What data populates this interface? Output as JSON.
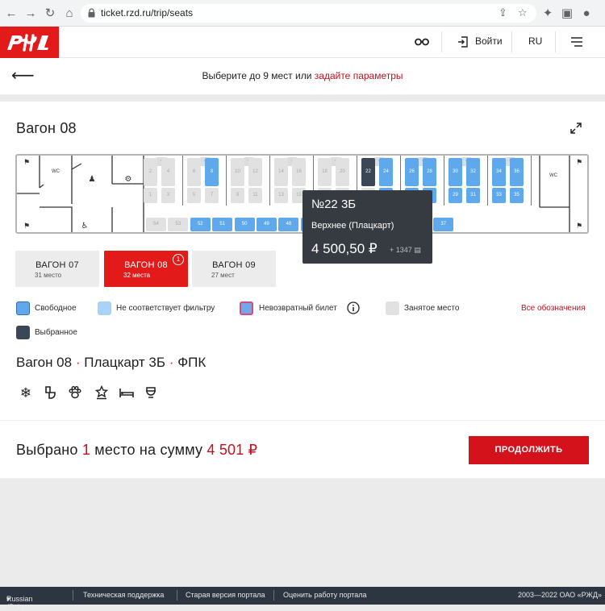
{
  "browser": {
    "url": "ticket.rzd.ru/trip/seats"
  },
  "header": {
    "logo_text": "РЖД",
    "login_label": "Войти",
    "lang_label": "RU"
  },
  "subheader": {
    "text": "Выберите до 9 мест или",
    "link": "задайте параметры"
  },
  "car": {
    "title": "Вагон 08",
    "wc_label": "WC"
  },
  "scheme": {
    "top_compartments": [
      {
        "upper": "2",
        "lower": "1",
        "upper_status": "taken",
        "lower_status": "taken"
      },
      {
        "upper": "4",
        "lower": "3",
        "upper_status": "taken",
        "lower_status": "taken"
      },
      {
        "upper": "6",
        "lower": "5",
        "upper_status": "taken",
        "lower_status": "taken"
      },
      {
        "upper": "8",
        "lower": "7",
        "upper_status": "free",
        "lower_status": "taken"
      },
      {
        "upper": "10",
        "lower": "9",
        "upper_status": "taken",
        "lower_status": "taken"
      },
      {
        "upper": "12",
        "lower": "11",
        "upper_status": "taken",
        "lower_status": "taken"
      },
      {
        "upper": "14",
        "lower": "13",
        "upper_status": "taken",
        "lower_status": "taken"
      },
      {
        "upper": "16",
        "lower": "15",
        "upper_status": "taken",
        "lower_status": "taken"
      },
      {
        "upper": "18",
        "lower": "17",
        "upper_status": "taken",
        "lower_status": "taken"
      },
      {
        "upper": "20",
        "lower": "19",
        "upper_status": "taken",
        "lower_status": "taken"
      },
      {
        "upper": "22",
        "lower": "21",
        "upper_status": "selected",
        "lower_status": "taken"
      },
      {
        "upper": "24",
        "lower": "23",
        "upper_status": "free",
        "lower_status": "free"
      },
      {
        "upper": "26",
        "lower": "25",
        "upper_status": "free",
        "lower_status": "free"
      },
      {
        "upper": "28",
        "lower": "27",
        "upper_status": "free",
        "lower_status": "free"
      },
      {
        "upper": "30",
        "lower": "29",
        "upper_status": "free",
        "lower_status": "free"
      },
      {
        "upper": "32",
        "lower": "31",
        "upper_status": "free",
        "lower_status": "free"
      },
      {
        "upper": "34",
        "lower": "33",
        "upper_status": "free",
        "lower_status": "free"
      },
      {
        "upper": "36",
        "lower": "35",
        "upper_status": "free",
        "lower_status": "free"
      }
    ],
    "side_seats": [
      {
        "label": "54",
        "status": "taken"
      },
      {
        "label": "53",
        "status": "taken"
      },
      {
        "label": "52",
        "status": "free"
      },
      {
        "label": "51",
        "status": "free"
      },
      {
        "label": "50",
        "status": "free"
      },
      {
        "label": "49",
        "status": "free"
      },
      {
        "label": "48",
        "status": "free"
      },
      {
        "label": "47",
        "status": "free"
      },
      {
        "label": "42",
        "status": "free"
      },
      {
        "label": "41",
        "status": "free"
      },
      {
        "label": "40",
        "status": "free"
      },
      {
        "label": "39",
        "status": "free"
      },
      {
        "label": "38",
        "status": "free"
      },
      {
        "label": "37",
        "status": "free"
      }
    ]
  },
  "tooltip": {
    "seat": "№22 3Б",
    "type": "Верхнее (Плацкарт)",
    "price": "4 500,50 ₽",
    "bonus": "+ 1347"
  },
  "wagon_tabs": [
    {
      "name": "ВАГОН 07",
      "count": "31 место",
      "active": false
    },
    {
      "name": "ВАГОН 08",
      "count": "32 места",
      "active": true,
      "badge": "1"
    },
    {
      "name": "ВАГОН 09",
      "count": "27 мест",
      "active": false
    }
  ],
  "legend": {
    "free": "Свободное",
    "no_filter": "Не соответствует фильтру",
    "nonrefundable": "Невозвратный билет",
    "taken": "Занятое место",
    "selected": "Выбранное",
    "all_link": "Все обозначения",
    "colors": {
      "free": "#5fa8ec",
      "no_filter": "#a9d2f7",
      "nonrefundable": "#d94b7e",
      "taken": "#e1e1e1",
      "selected": "#3b4756"
    }
  },
  "car_info": {
    "car": "Вагон 08",
    "class": "Плацкарт 3Б",
    "carrier": "ФПК",
    "amenities": [
      "snowflake-icon",
      "toilet-icon",
      "pet-icon",
      "award-icon",
      "bed-icon",
      "food-icon"
    ]
  },
  "summary": {
    "prefix": "Выбрано",
    "count": "1",
    "middle": "место на сумму",
    "amount": "4 501 ₽",
    "continue_label": "ПРОДОЛЖИТЬ"
  },
  "footer": {
    "lang": "Russian (Ru)",
    "support": "Техническая поддержка",
    "old_version": "Старая версия портала",
    "rate": "Оценить работу портала",
    "copyright": "2003—2022 ОАО «РЖД»"
  }
}
